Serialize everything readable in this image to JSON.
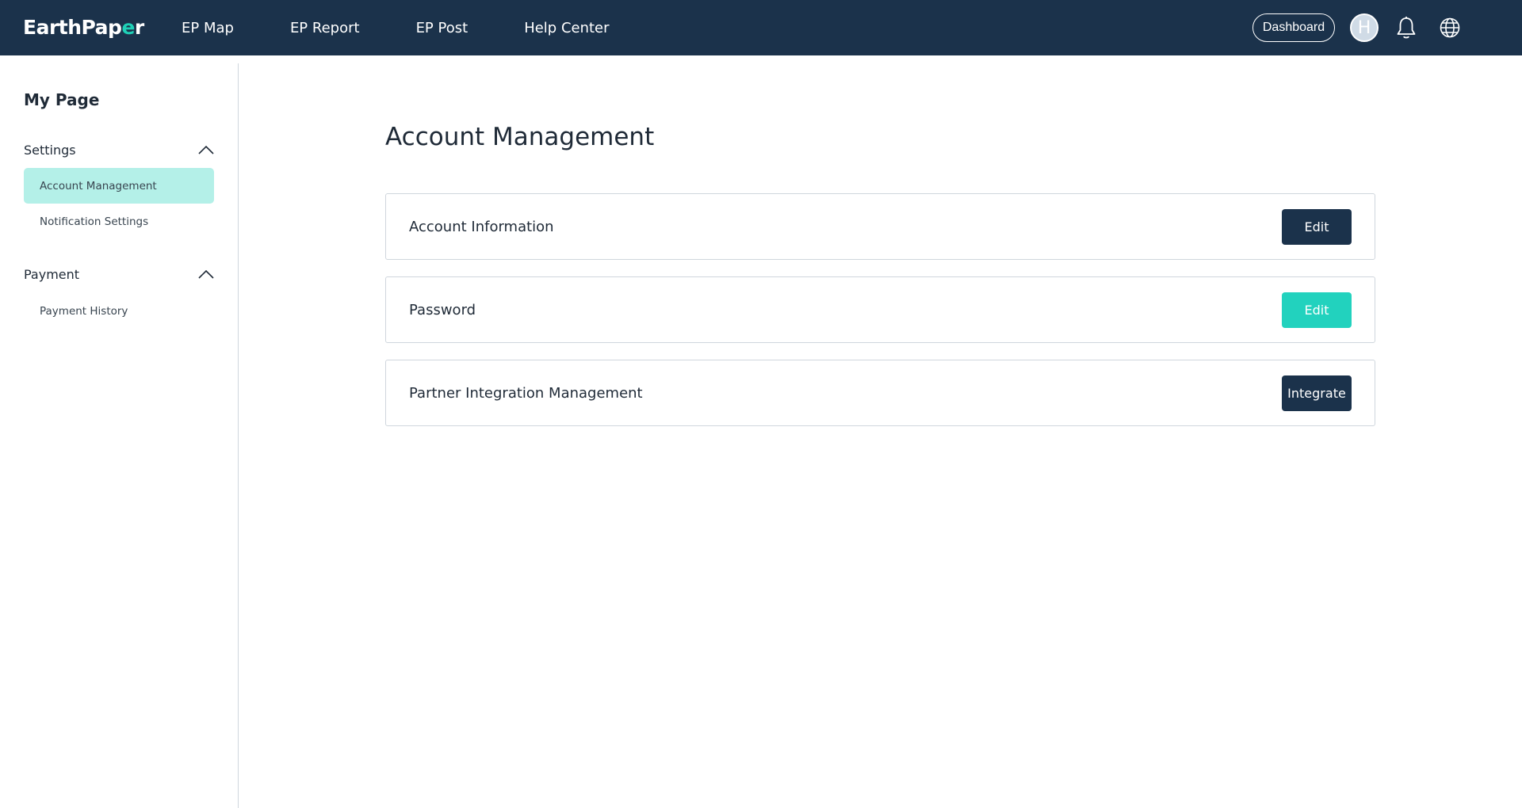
{
  "header": {
    "logo_part1": "EarthPap",
    "logo_accent": "e",
    "logo_part2": "r",
    "nav": [
      "EP Map",
      "EP Report",
      "EP Post",
      "Help Center"
    ],
    "dashboard_label": "Dashboard",
    "avatar_initial": "H",
    "colors": {
      "background": "#1b324b",
      "accent": "#1fd0b6"
    }
  },
  "sidebar": {
    "title": "My Page",
    "sections": [
      {
        "label": "Settings",
        "expanded": true,
        "items": [
          {
            "label": "Account Management",
            "active": true
          },
          {
            "label": "Notification Settings",
            "active": false
          }
        ]
      },
      {
        "label": "Payment",
        "expanded": true,
        "items": [
          {
            "label": "Payment History",
            "active": false
          }
        ]
      }
    ],
    "active_color": "#b4f0e8"
  },
  "main": {
    "title": "Account Management",
    "cards": [
      {
        "label": "Account Information",
        "button": "Edit",
        "button_color": "#1b324b"
      },
      {
        "label": "Password",
        "button": "Edit",
        "button_color": "#22d2be"
      },
      {
        "label": "Partner Integration Management",
        "button": "Integrate",
        "button_color": "#1b324b"
      }
    ]
  }
}
